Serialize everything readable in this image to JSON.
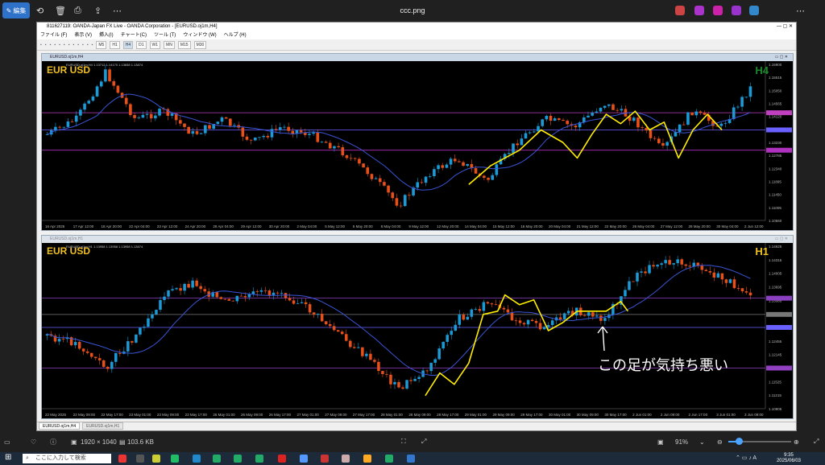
{
  "viewer": {
    "edit_label": "編集",
    "file_name": "ccc.png",
    "dimensions": "1920 × 1040",
    "file_size": "103.6 KB",
    "zoom": "91%"
  },
  "mt4": {
    "title": "811627119: OANDA-Japan FX Live - OANDA Corporation - [EURUSD.oj1m,H4]",
    "menu": [
      "ファイル (F)",
      "表示 (V)",
      "挿入(I)",
      "チャート(C)",
      "ツール (T)",
      "ウィンドウ (W)",
      "ヘルプ (H)"
    ],
    "timeframes": [
      "M5",
      "H1",
      "H4",
      "D1",
      "W1",
      "MN",
      "M15",
      "M30"
    ],
    "active_tf": "H4",
    "tabs": [
      "EURUSD.oj1m,H4",
      "EURUSD.oj1m,H1"
    ]
  },
  "chart_h4": {
    "caption": "EURUSD.oj1m,H4",
    "symbol": "EUR USD",
    "tf_label": "H4",
    "tf_color": "#1a8a2a",
    "ohlc": "EURUSD.oj1m,H4 1.13712 1.14170 1.13658 1.13874",
    "prices": [
      "1.15900",
      "1.15515",
      "1.15050",
      "1.14565",
      "1.14120",
      "1.13675",
      "1.13230",
      "1.12785",
      "1.12340",
      "1.11895",
      "1.11450",
      "1.11005",
      "1.10560"
    ],
    "dates": [
      "16 Apr 2025",
      "17 Apr 12:00",
      "18 Apr 20:00",
      "22 Apr 04:00",
      "23 Apr 12:00",
      "24 Apr 20:00",
      "28 Apr 04:00",
      "29 Apr 12:00",
      "30 Apr 20:00",
      "2 May 04:00",
      "5 May 12:00",
      "6 May 20:00",
      "8 May 04:00",
      "9 May 12:00",
      "12 May 20:00",
      "14 May 04:00",
      "15 May 12:00",
      "16 May 20:00",
      "20 May 04:00",
      "21 May 12:00",
      "22 May 20:00",
      "26 May 04:00",
      "27 May 12:00",
      "28 May 20:00",
      "30 May 04:00",
      "2 Jun 12:00"
    ]
  },
  "chart_h1": {
    "caption": "EURUSD.oj1m,H1",
    "symbol": "EUR USD",
    "tf_label": "H1",
    "tf_color": "#f0c020",
    "ohlc": "EURUSD.oj1m,H1 1.13958 1.13958 1.13958 1.13874",
    "prices": [
      "1.14625",
      "1.14315",
      "1.14005",
      "1.13695",
      "1.13385",
      "1.13075",
      "1.12765",
      "1.12455",
      "1.12145",
      "1.11835",
      "1.11525",
      "1.11215",
      "1.10905"
    ],
    "dates": [
      "22 May 2025",
      "22 May 09:00",
      "22 May 17:00",
      "23 May 01:00",
      "23 May 09:00",
      "23 May 17:00",
      "26 May 01:00",
      "26 May 09:00",
      "26 May 17:00",
      "27 May 01:00",
      "27 May 09:00",
      "27 May 17:00",
      "28 May 01:00",
      "28 May 09:00",
      "28 May 17:00",
      "29 May 01:00",
      "29 May 09:00",
      "29 May 17:00",
      "30 May 01:00",
      "30 May 09:00",
      "30 May 17:00",
      "2 Jun 01:00",
      "2 Jun 09:00",
      "2 Jun 17:00",
      "3 Jun 01:00",
      "3 Jun 09:00"
    ],
    "annotation": "この足が気持ち悪い"
  },
  "taskbar": {
    "search_placeholder": "ここに入力して検索",
    "time": "9:35",
    "date": "2025/06/03"
  },
  "colors": {
    "bull": "#1a9ad6",
    "bear": "#e8501a",
    "ma": "#3a55d8",
    "highlight": "#ffee00"
  }
}
